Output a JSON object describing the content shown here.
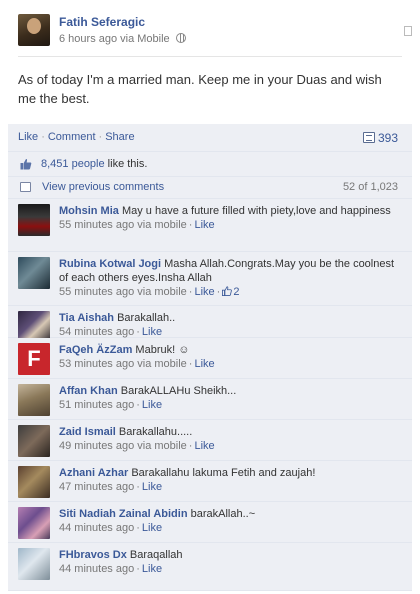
{
  "post": {
    "author": "Fatih Seferagic",
    "time": "6 hours ago via Mobile",
    "status_text": "As of today I'm a married man. Keep me in your Duas and wish me the best."
  },
  "actions": {
    "like": "Like",
    "comment": "Comment",
    "share": "Share",
    "comment_count": "393"
  },
  "likes": {
    "count": "8,451 people",
    "suffix": " like this."
  },
  "previous": {
    "link": "View previous comments",
    "count": "52 of 1,023"
  },
  "comments": [
    {
      "name": "Mohsin Mia",
      "text": "May u have a future filled with piety,love and happiness",
      "time": "55 minutes ago via mobile",
      "like": "Like",
      "likes": ""
    },
    {
      "name": "Rubina Kotwal Jogi",
      "text": "Masha Allah.Congrats.May you be the coolnest of each others eyes.Insha Allah",
      "time": "55 minutes ago via mobile",
      "like": "Like",
      "likes": "2"
    },
    {
      "name": "Tia Aishah",
      "text": "Barakallah..",
      "time": "54 minutes ago",
      "like": "Like",
      "likes": ""
    },
    {
      "name": "FaQeh ÄzZam",
      "text": "Mabruk! ☺",
      "time": "53 minutes ago via mobile",
      "like": "Like",
      "likes": ""
    },
    {
      "name": "Affan Khan",
      "text": "BarakALLAHu Sheikh...",
      "time": "51 minutes ago",
      "like": "Like",
      "likes": ""
    },
    {
      "name": "Zaid Ismail",
      "text": "Barakallahu.....",
      "time": "49 minutes ago via mobile",
      "like": "Like",
      "likes": ""
    },
    {
      "name": "Azhani Azhar",
      "text": "Barakallahu lakuma Fetih and zaujah!",
      "time": "47 minutes ago",
      "like": "Like",
      "likes": ""
    },
    {
      "name": "Siti Nadiah Zainal Abidin",
      "text": "barakAllah..~",
      "time": "44 minutes ago",
      "like": "Like",
      "likes": ""
    },
    {
      "name": "FHbravos Dx",
      "text": "Baraqallah",
      "time": "44 minutes ago",
      "like": "Like",
      "likes": ""
    }
  ],
  "avatar4_letter": "F",
  "colors": {
    "link": "#3b5998",
    "panel": "#edeff4",
    "meta": "#777777"
  },
  "icons": [
    "globe-icon",
    "comment-bubble-icon",
    "thumbs-up-icon",
    "previous-comments-icon"
  ]
}
